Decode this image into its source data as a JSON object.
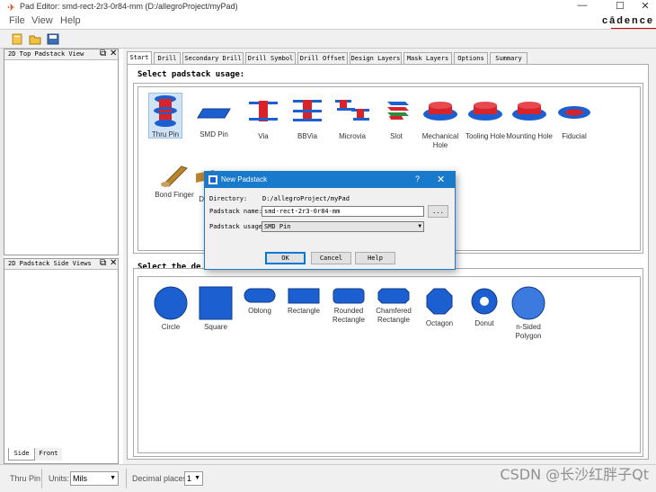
{
  "window": {
    "title": "Pad Editor: smd-rect-2r3-0r84-mm  (D:/allegroProject/myPad)",
    "controls": [
      "—",
      "☐",
      "✕"
    ],
    "brand": "cādence"
  },
  "menu": [
    "File",
    "View",
    "Help"
  ],
  "toolbar": [
    "new-file-icon",
    "open-folder-icon",
    "save-icon"
  ],
  "left_panels": {
    "top_view": {
      "title": "2D Top Padstack View"
    },
    "side_view": {
      "title": "2D Padstack Side Views"
    },
    "side_tabs": [
      "Side",
      "Front"
    ]
  },
  "tabs": [
    "Start",
    "Drill",
    "Secondary Drill",
    "Drill Symbol",
    "Drill Offset",
    "Design Layers",
    "Mask Layers",
    "Options",
    "Summary"
  ],
  "active_tab": "Start",
  "usage_section": {
    "heading": "Select padstack usage:",
    "items": [
      {
        "label": "Thru Pin",
        "icon": "thru-pin-icon",
        "selected": true
      },
      {
        "label": "SMD Pin",
        "icon": "smd-pin-icon"
      },
      {
        "label": "Via",
        "icon": "via-icon"
      },
      {
        "label": "BBVia",
        "icon": "bbvia-icon"
      },
      {
        "label": "Microvia",
        "icon": "microvia-icon"
      },
      {
        "label": "Slot",
        "icon": "slot-icon"
      },
      {
        "label": "Mechanical Hole",
        "icon": "mechanical-hole-icon"
      },
      {
        "label": "Tooling Hole",
        "icon": "tooling-hole-icon"
      },
      {
        "label": "Mounting Hole",
        "icon": "mounting-hole-icon"
      },
      {
        "label": "Fiducial",
        "icon": "fiducial-icon"
      },
      {
        "label": "Bond Finger",
        "icon": "bond-finger-icon"
      },
      {
        "label": "Di",
        "icon": "die-pad-icon"
      }
    ]
  },
  "shape_section": {
    "heading": "Select the de",
    "items": [
      {
        "label": "Circle",
        "icon": "circle-shape-icon"
      },
      {
        "label": "Square",
        "icon": "square-shape-icon"
      },
      {
        "label": "Oblong",
        "icon": "oblong-shape-icon"
      },
      {
        "label": "Rectangle",
        "icon": "rectangle-shape-icon"
      },
      {
        "label": "Rounded Rectangle",
        "icon": "rounded-rectangle-shape-icon"
      },
      {
        "label": "Chamfered Rectangle",
        "icon": "chamfered-rectangle-shape-icon"
      },
      {
        "label": "Octagon",
        "icon": "octagon-shape-icon"
      },
      {
        "label": "Donut",
        "icon": "donut-shape-icon"
      },
      {
        "label": "n-Sided Polygon",
        "icon": "n-sided-polygon-shape-icon"
      }
    ]
  },
  "statusbar": {
    "usage": "Thru Pin",
    "units_label": "Units:",
    "units_value": "Mils",
    "decimal_label": "Decimal places:",
    "decimal_value": "1"
  },
  "dialog": {
    "title": "New Padstack",
    "help_glyph": "?",
    "close_glyph": "✕",
    "directory_label": "Directory:",
    "directory_value": "D:/allegroProject/myPad",
    "name_label": "Padstack name:",
    "name_value": "smd-rect-2r3-0r84-mm",
    "browse_label": "...",
    "usage_label": "Padstack usage:",
    "usage_value": "SMD Pin",
    "ok_label": "OK",
    "cancel_label": "Cancel",
    "help_label": "Help"
  },
  "watermark": "CSDN @长沙红胖子Qt",
  "colors": {
    "pad_blue": "#1c5fd1",
    "drill_red": "#d8232a",
    "dialog_accent": "#1979ca",
    "selection": "#cfe3f7"
  }
}
